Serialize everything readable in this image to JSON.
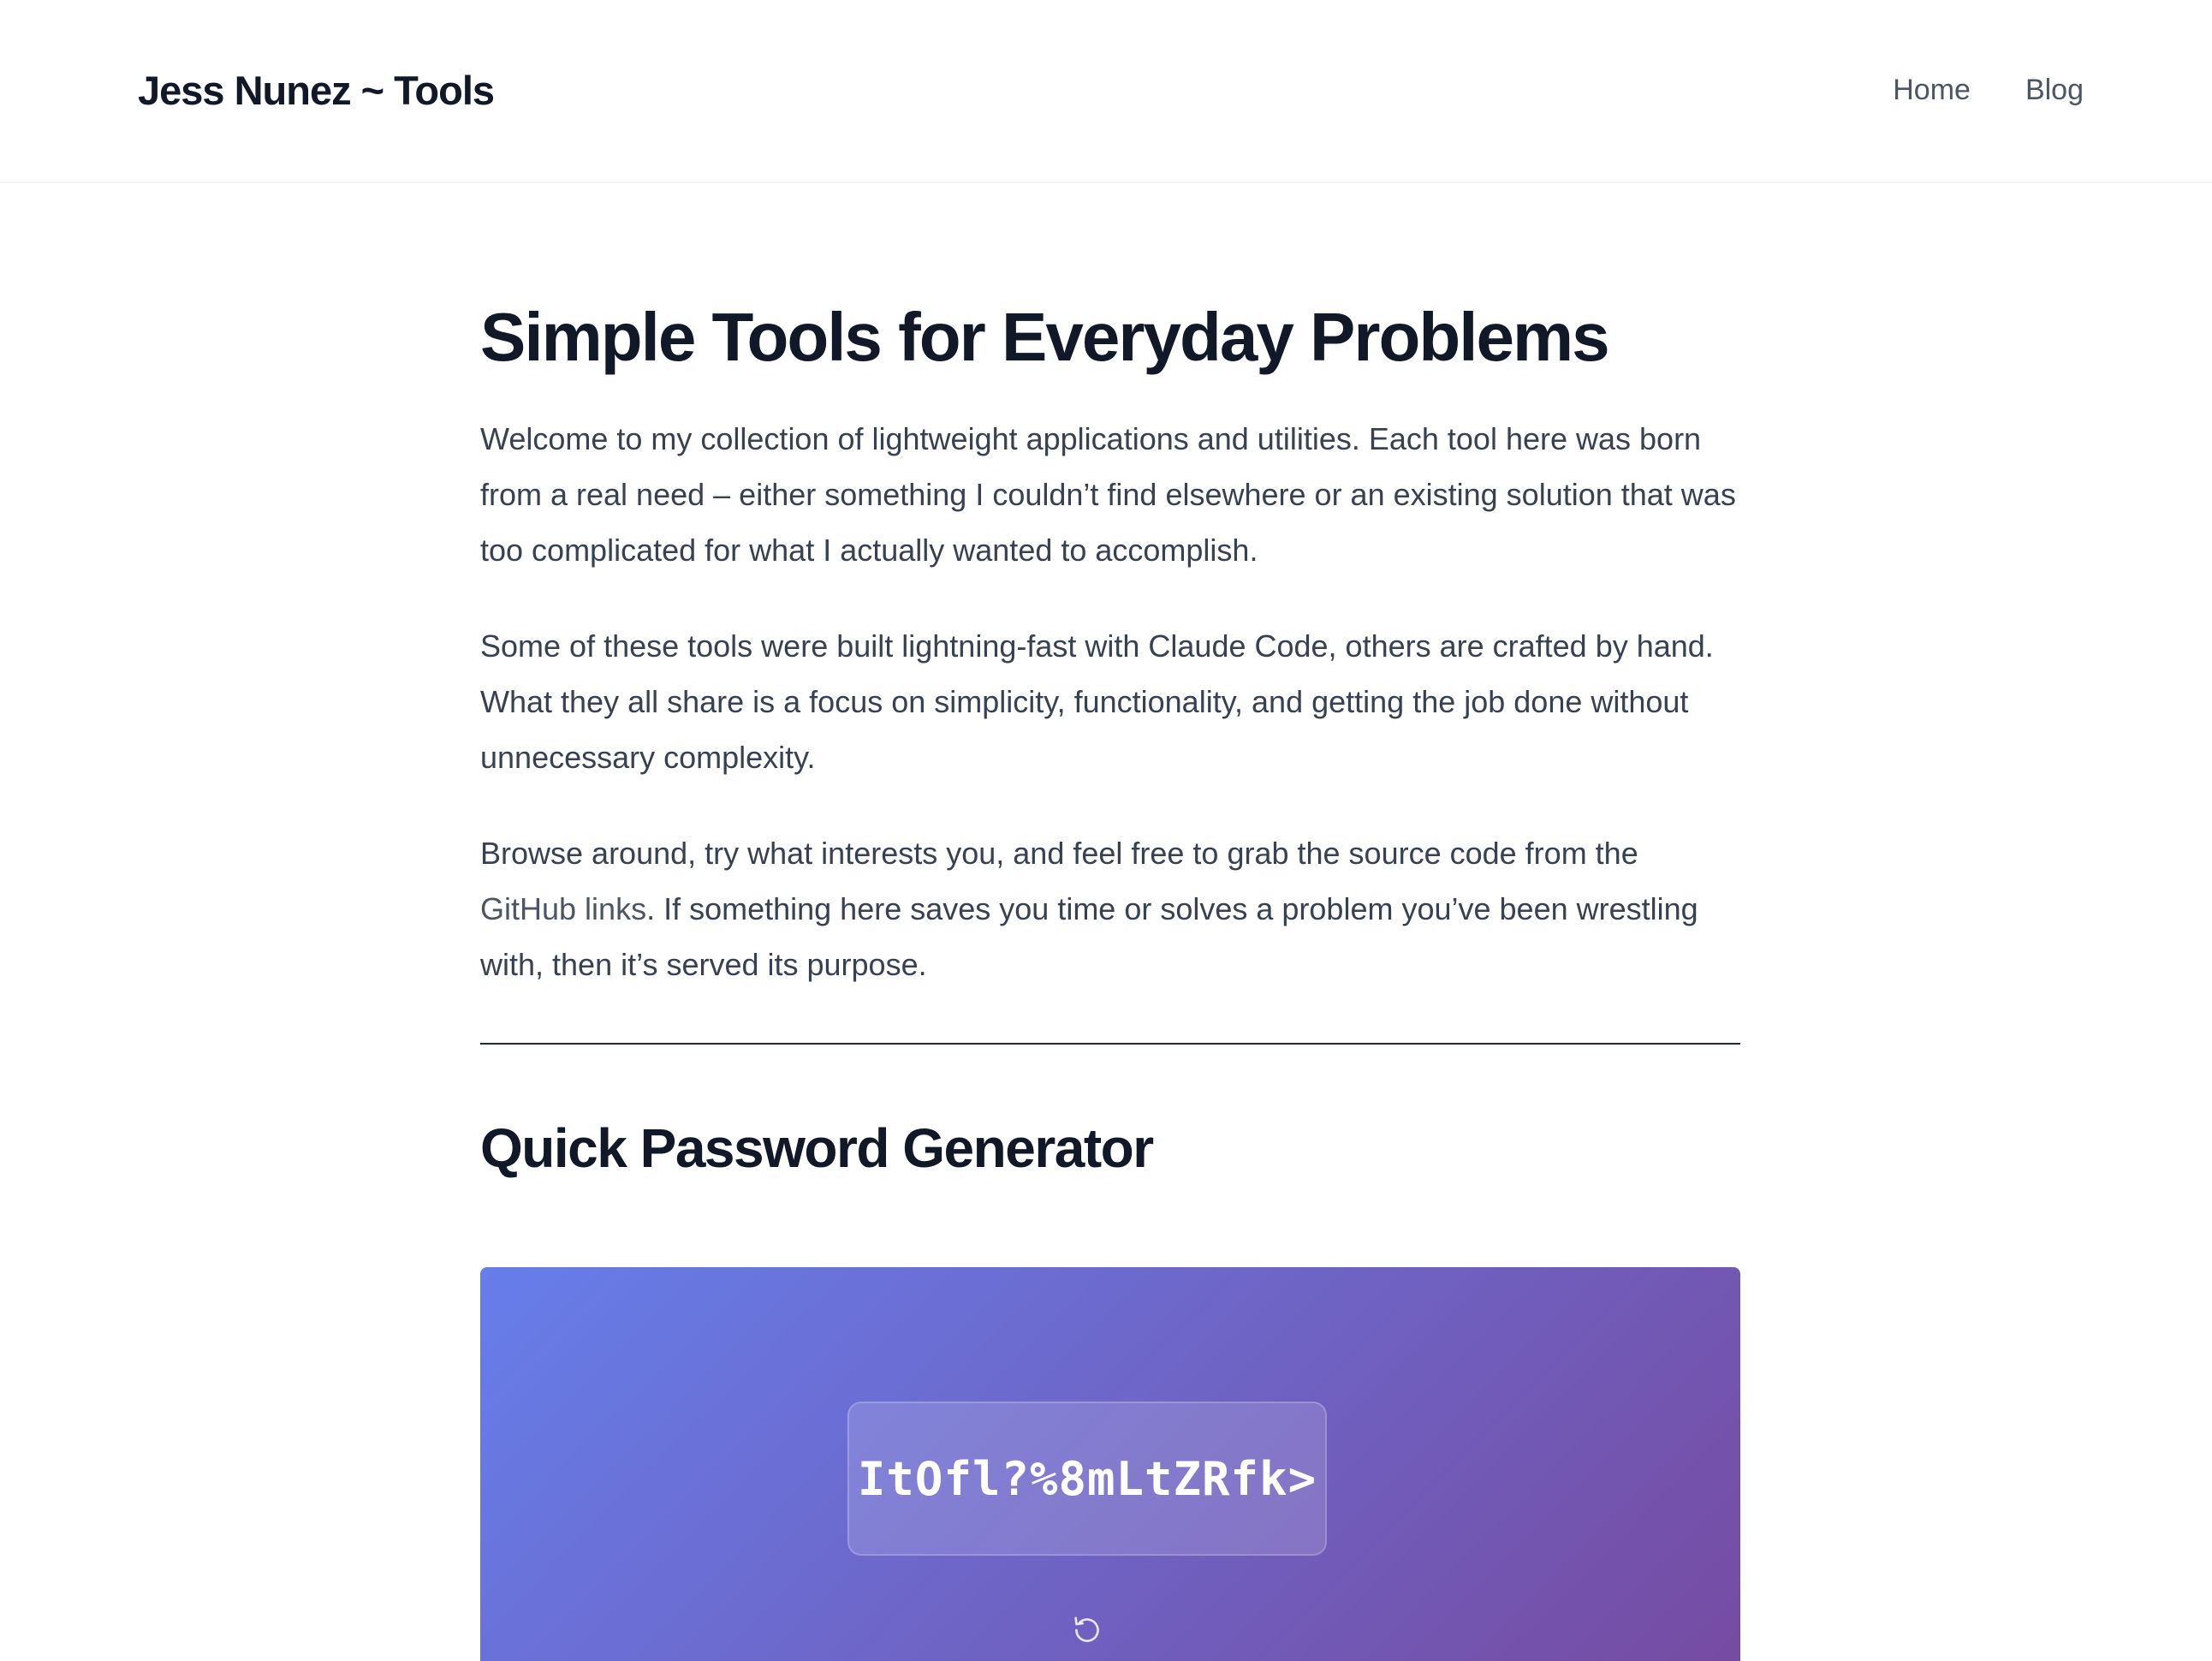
{
  "header": {
    "brand": "Jess Nunez ~ Tools",
    "nav": [
      {
        "label": "Home"
      },
      {
        "label": "Blog"
      }
    ]
  },
  "main": {
    "title": "Simple Tools for Everyday Problems",
    "intro_paragraph_1": "Welcome to my collection of lightweight applications and utilities. Each tool here was born from a real need – either something I couldn’t find elsewhere or an existing solution that was too complicated for what I actually wanted to accomplish.",
    "intro_paragraph_2": "Some of these tools were built lightning-fast with Claude Code, others are crafted by hand. What they all share is a focus on simplicity, functionality, and getting the job done without unnecessary complexity.",
    "intro_paragraph_3": {
      "before_link": "Browse around, try what interests you, and feel free to grab the source code from the ",
      "link_text": "GitHub links",
      "after_link": ". If something here saves you time or solves a problem you’ve been wrestling with, then it’s served its purpose."
    }
  },
  "password_generator": {
    "section_title": "Quick Password Generator",
    "password": "ItOfl?%8mLtZRfk>",
    "refresh_icon": "refresh-icon",
    "gradient_start": "#667eea",
    "gradient_end": "#764ba2"
  }
}
